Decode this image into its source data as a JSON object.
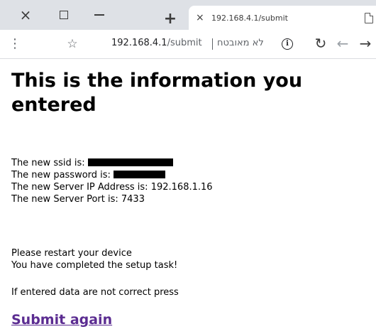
{
  "browser": {
    "tab": {
      "title": "192.168.4.1/submit",
      "close_glyph": "×"
    },
    "window_controls": {
      "close_glyph": "×",
      "new_tab_glyph": "+"
    },
    "address_bar": {
      "host": "192.168.4.1",
      "path": "/submit",
      "security_label": "לא מאובטח",
      "info_glyph": "i"
    },
    "toolbar": {
      "menu_glyph": "⋮",
      "star_glyph": "☆",
      "reload_glyph": "↻",
      "back_glyph": "←",
      "forward_glyph": "→"
    },
    "icons": [
      "close-icon",
      "maximize-icon",
      "minimize-icon",
      "new-tab-icon",
      "page-icon",
      "menu-icon",
      "star-icon",
      "info-icon",
      "reload-icon",
      "back-icon",
      "forward-icon"
    ]
  },
  "page": {
    "heading": "This is the information you entered",
    "fields": {
      "ssid_label": "The new ssid is:",
      "password_label": "The new password is:",
      "server_ip_label": "The new Server IP Address is:",
      "server_ip_value": "192.168.1.16",
      "server_port_label": "The new Server Port is:",
      "server_port_value": "7433"
    },
    "messages": {
      "restart": "Please restart your device",
      "completed": "You have completed the setup task!",
      "incorrect_note": "If entered data are not correct press"
    },
    "submit_again_label": "Submit again",
    "link_color": "#5b2c91"
  }
}
